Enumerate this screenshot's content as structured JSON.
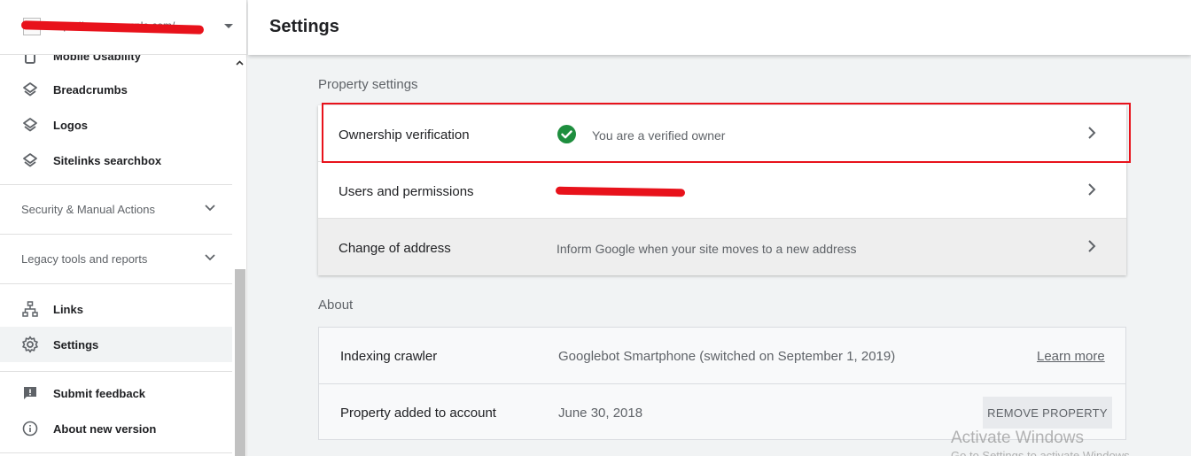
{
  "property": {
    "url": "https://www.example.com/",
    "redacted": true
  },
  "sidebar": {
    "items_top": [
      {
        "label": "Mobile Usability",
        "icon": "mobile-icon"
      },
      {
        "label": "Breadcrumbs",
        "icon": "layers-icon"
      },
      {
        "label": "Logos",
        "icon": "layers-icon"
      },
      {
        "label": "Sitelinks searchbox",
        "icon": "layers-icon"
      }
    ],
    "sections": [
      {
        "label": "Security & Manual Actions"
      },
      {
        "label": "Legacy tools and reports"
      }
    ],
    "items_bottom": [
      {
        "label": "Links",
        "icon": "sitemap-icon"
      },
      {
        "label": "Settings",
        "icon": "gear-icon",
        "active": true
      }
    ],
    "footer": [
      {
        "label": "Submit feedback",
        "icon": "feedback-icon"
      },
      {
        "label": "About new version",
        "icon": "info-icon"
      }
    ]
  },
  "header": {
    "title": "Settings"
  },
  "property_settings": {
    "title": "Property settings",
    "rows": [
      {
        "name": "Ownership verification",
        "value": "You are a verified owner"
      },
      {
        "name": "Users and permissions",
        "value": ""
      },
      {
        "name": "Change of address",
        "value": "Inform Google when your site moves to a new address"
      }
    ]
  },
  "about": {
    "title": "About",
    "rows": [
      {
        "name": "Indexing crawler",
        "value": "Googlebot Smartphone (switched on September 1, 2019)",
        "link": "Learn more"
      },
      {
        "name": "Property added to account",
        "value": "June 30, 2018",
        "button": "REMOVE PROPERTY"
      }
    ]
  },
  "watermark": {
    "line1": "Activate Windows",
    "line2": "Go to Settings to activate Windows."
  },
  "colors": {
    "accent": "#1a73e8",
    "success": "#1e8e3e",
    "annotation": "#e8121b"
  }
}
